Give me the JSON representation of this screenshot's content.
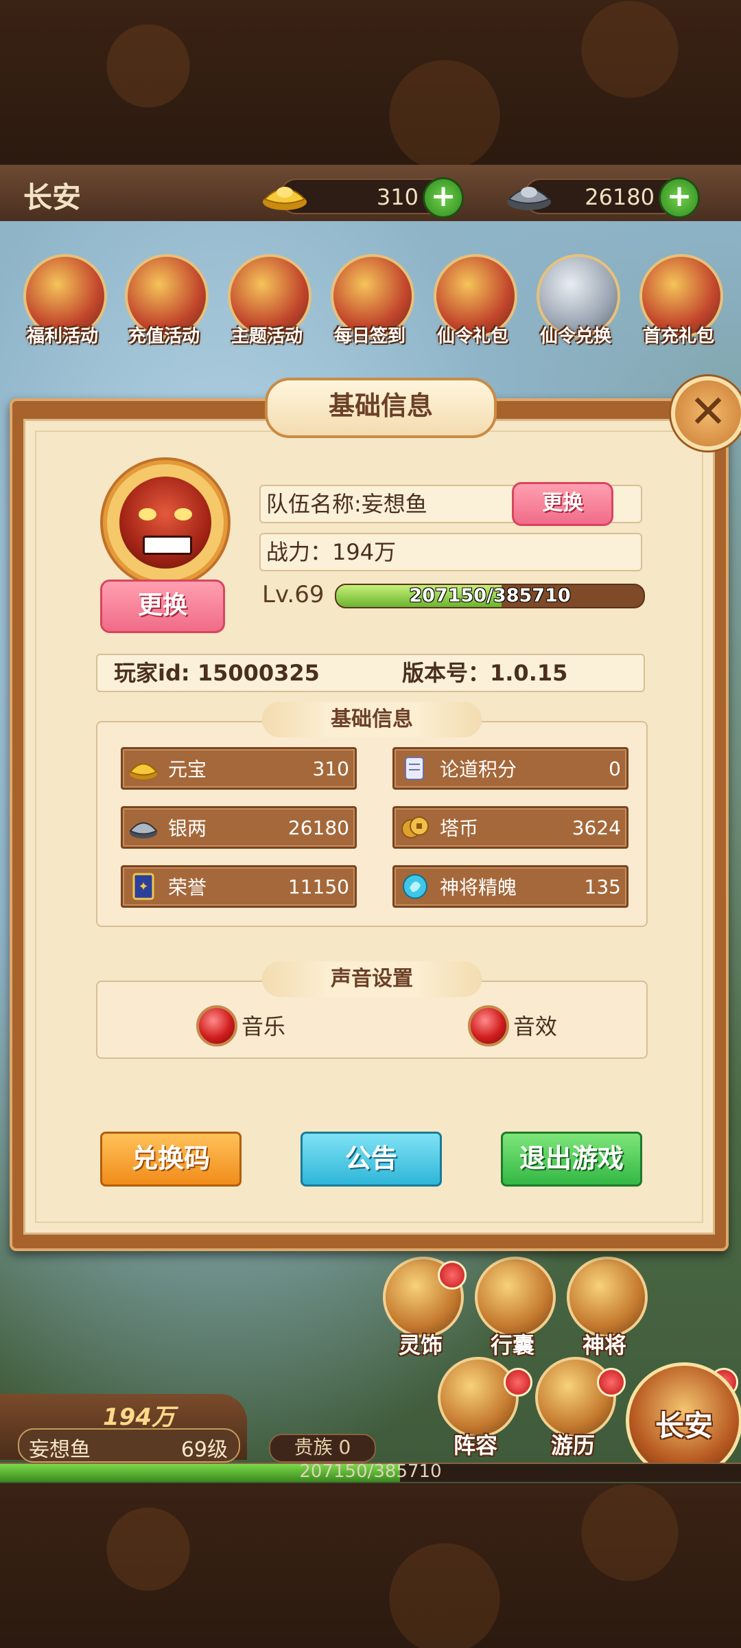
{
  "header": {
    "city": "长安",
    "gold_value": "310",
    "silver_value": "26180"
  },
  "activities": [
    {
      "label": "福利活动",
      "icon": "gift-bag-icon"
    },
    {
      "label": "充值活动",
      "icon": "treasure-icon"
    },
    {
      "label": "主题活动",
      "icon": "theme-icon"
    },
    {
      "label": "每日签到",
      "icon": "calendar-icon"
    },
    {
      "label": "仙令礼包",
      "icon": "gift-icon"
    },
    {
      "label": "仙令兑换",
      "icon": "chest-icon"
    },
    {
      "label": "首充礼包",
      "icon": "chest-icon"
    }
  ],
  "dialog": {
    "title": "基础信息",
    "change_avatar_label": "更换",
    "team_name_label": "队伍名称:妄想鱼",
    "change_name_label": "更换",
    "power_label": "战力：194万",
    "level_label": "Lv.69",
    "exp_text": "207150/385710",
    "exp_progress": 0.537,
    "player_id_label": "玩家id: 15000325",
    "version_label": "版本号：1.0.15",
    "resources_title": "基础信息",
    "resources": [
      {
        "name": "元宝",
        "value": "310",
        "icon": "gold-ingot-icon"
      },
      {
        "name": "论道积分",
        "value": "0",
        "icon": "scroll-icon"
      },
      {
        "name": "银两",
        "value": "26180",
        "icon": "silver-ingot-icon"
      },
      {
        "name": "塔币",
        "value": "3624",
        "icon": "coin-icon"
      },
      {
        "name": "荣誉",
        "value": "11150",
        "icon": "honor-badge-icon"
      },
      {
        "name": "神将精魄",
        "value": "135",
        "icon": "soul-gem-icon"
      }
    ],
    "sound_title": "声音设置",
    "music_label": "音乐",
    "sfx_label": "音效",
    "redeem_label": "兑换码",
    "notice_label": "公告",
    "quit_label": "退出游戏"
  },
  "hud": {
    "power": "194万",
    "player_name": "妄想鱼",
    "player_level": "69级",
    "noble": "贵族 0",
    "exp_text": "207150/385710",
    "nav": [
      {
        "label": "灵饰"
      },
      {
        "label": "行囊"
      },
      {
        "label": "神将"
      },
      {
        "label": "阵容"
      },
      {
        "label": "游历"
      }
    ],
    "city": "长安"
  },
  "colors": {
    "panel_bg": "#f6e7c6",
    "frame": "#a8632c",
    "pink_button": "#f06c88",
    "orange_button": "#f08c1a",
    "cyan_button": "#2fb6d8",
    "green_button": "#34b845"
  }
}
